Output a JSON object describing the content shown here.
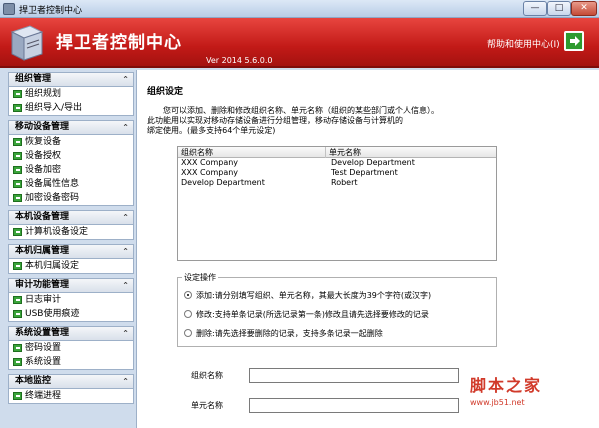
{
  "window": {
    "title": "捍卫者控制中心",
    "buttons": {
      "minimize": "—",
      "maximize": "□",
      "close": "✕"
    }
  },
  "header": {
    "app_name": "捍卫者控制中心",
    "version": "Ver 2014 5.6.0.0",
    "help_label": "帮助和使用中心(I)",
    "help_icon": "arrow-right-icon"
  },
  "sidebar": {
    "groups": [
      {
        "title": "组织管理",
        "items": [
          "组织规划",
          "组织导入/导出"
        ]
      },
      {
        "title": "移动设备管理",
        "items": [
          "恢复设备",
          "设备授权",
          "设备加密",
          "设备属性信息",
          "加密设备密码"
        ]
      },
      {
        "title": "本机设备管理",
        "items": [
          "计算机设备设定"
        ]
      },
      {
        "title": "本机归属管理",
        "items": [
          "本机归属设定"
        ]
      },
      {
        "title": "审计功能管理",
        "items": [
          "日志审计",
          "USB使用痕迹"
        ]
      },
      {
        "title": "系统设置管理",
        "items": [
          "密码设置",
          "系统设置"
        ]
      },
      {
        "title": "本地监控",
        "items": [
          "终端进程"
        ]
      }
    ]
  },
  "main": {
    "section_title": "组织设定",
    "description_lines": [
      "您可以添加、删除和修改组织名称、单元名称（组织的某些部门或个人信息）。",
      "此功能用以实现对移动存储设备进行分组管理，移动存储设备与计算机的",
      "绑定使用。(最多支持64个单元设定)"
    ],
    "table": {
      "columns": [
        "组织名称",
        "单元名称"
      ],
      "rows": [
        [
          "XXX Company",
          "Develop Department"
        ],
        [
          "XXX Company",
          "Test Department"
        ],
        [
          "Develop Department",
          "Robert"
        ]
      ]
    },
    "operations": {
      "legend": "设定操作",
      "options": [
        {
          "label": "添加:请分别填写组织、单元名称，其最大长度为39个字符(或汉字)",
          "selected": true
        },
        {
          "label": "修改:支持单条记录(所选记录第一条)修改且请先选择要修改的记录",
          "selected": false
        },
        {
          "label": "删除:请先选择要删除的记录，支持多条记录一起删除",
          "selected": false
        }
      ]
    },
    "fields": {
      "org_name_label": "组织名称",
      "org_name_value": "",
      "unit_name_label": "单元名称",
      "unit_name_value": ""
    }
  },
  "watermark": {
    "text": "脚本之家",
    "url": "www.jb51.net"
  },
  "colors": {
    "banner": "#c21a17",
    "accent_green": "#3aa43a"
  }
}
